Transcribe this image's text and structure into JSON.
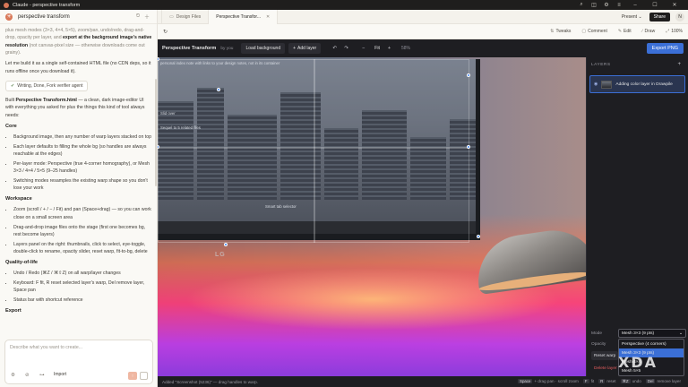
{
  "window": {
    "title": "Claude - perspective transform"
  },
  "chat": {
    "title": "perspective transform",
    "intro_text": "plus mesh modes (3×3, 4×4, 5×5), zoom/pan, undo/redo, drag-and-drop, opacity per layer, and",
    "intro_bold": "export at the background image's native resolution",
    "intro_tail": "(not canvas-pixel size — otherwise downloads come out grainy).",
    "build_line": "Let me build it as a single self-contained HTML file (no CDN deps, so it runs offline once you download it).",
    "agent_chip": "Writing, Done, Fork verifier agent",
    "built_prefix": "Built",
    "built_bold": "Perspective Transform.html",
    "built_text": "— a clean, dark image-editor UI with everything you asked for plus the things this kind of tool always needs:",
    "sections": [
      {
        "heading": "Core",
        "items": [
          "Background image, then any number of warp layers stacked on top",
          "Each layer defaults to filling the whole bg (so handles are always reachable at the edges)",
          "Per-layer mode: Perspective (true 4-corner homography), or Mesh 3×3 / 4×4 / 5×5 (9–25 handles)",
          "Switching modes resamples the existing warp shape so you don't lose your work"
        ]
      },
      {
        "heading": "Workspace",
        "items": [
          "Zoom (scroll / + / − / Fit) and pan (Space+drag) — so you can work close on a small screen area",
          "Drag-and-drop image files onto the stage (first one becomes bg, rest become layers)",
          "Layers panel on the right: thumbnails, click to select, eye-toggle, double-click to rename, opacity slider, reset warp, fit-to-bg, delete"
        ]
      },
      {
        "heading": "Quality-of-life",
        "items": [
          "Undo / Redo (⌘Z / ⌘⇧Z) on all warp/layer changes",
          "Keyboard: F fit, R reset selected layer's warp, Del remove layer, Space pan",
          "Status bar with shortcut reference"
        ]
      },
      {
        "heading": "Export",
        "items": []
      }
    ],
    "composer": {
      "placeholder": "Describe what you want to create...",
      "import_label": "Import"
    }
  },
  "tabs": {
    "items": [
      {
        "label": "Design Files",
        "active": false
      },
      {
        "label": "Perspective Transfor...",
        "active": true
      }
    ],
    "present_label": "Present",
    "share_label": "Share",
    "user_initial": "N"
  },
  "artifact_toolbar": {
    "tweaks": "Tweaks",
    "comment": "Comment",
    "edit": "Edit",
    "draw": "Draw",
    "zoom": "100%"
  },
  "app": {
    "title": "Perspective Transform",
    "by": "by you",
    "load_background": "Load background",
    "add_layer": "Add layer",
    "fit": "Fit",
    "zoom": "58%",
    "export": "Export PNG",
    "status_text": "Added \"Screenshot (5236)\" — drag handles to warp.",
    "shortcuts": [
      {
        "key": "Space",
        "desc": "+ drag pan · scroll zoom"
      },
      {
        "key": "F",
        "desc": "fit"
      },
      {
        "key": "R",
        "desc": "reset"
      },
      {
        "key": "⌘Z",
        "desc": "undo"
      },
      {
        "key": "Del",
        "desc": "remove layer"
      }
    ],
    "overlay_texts": [
      "personal index note with links to your design notes, not in its container",
      "Slid over",
      "Sequel to 5 related files",
      "Smart tab selector",
      "Create a fit and warp and convert, media things smaller and more accessible"
    ],
    "brand_text": "LG",
    "layers": {
      "heading": "LAYERS",
      "items": [
        {
          "name": "Adding color layer in Drawpile"
        }
      ],
      "mode_label": "Mode",
      "mode_value": "Mesh 3×3 (9 pts)",
      "opacity_label": "Opacity",
      "mode_options": [
        {
          "label": "Perspective (4 corners)",
          "selected": false
        },
        {
          "label": "Mesh 3×3 (9 pts)",
          "selected": true
        },
        {
          "label": "Mesh 4×4",
          "selected": false
        },
        {
          "label": "Mesh 5×5",
          "selected": false
        }
      ],
      "reset_label": "Reset warp",
      "delete_label": "Delete layer"
    }
  },
  "watermark": "XDA",
  "colors": {
    "accent": "#3b6fd6",
    "claude_orange": "#d97757",
    "danger": "#e35d5d"
  }
}
